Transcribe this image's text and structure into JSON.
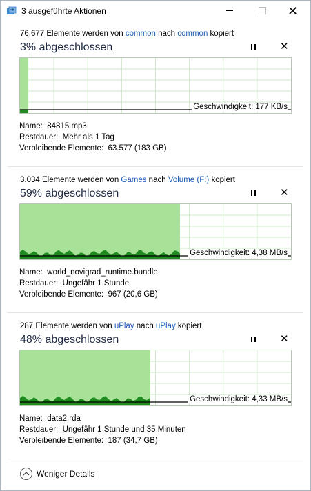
{
  "window": {
    "title": "3 ausgeführte Aktionen",
    "icon": "copy-files-icon",
    "controls": [
      "minimize-icon",
      "maximize-icon",
      "close-icon"
    ]
  },
  "operations": [
    {
      "count": "76.677",
      "text_mid": " Elemente werden von ",
      "source": "common",
      "text_to": " nach ",
      "dest": "common",
      "text_end": " kopiert",
      "percent_label": "3% abgeschlossen",
      "progress": 0.03,
      "speed_label": "Geschwindigkeit: 177 KB/s",
      "name_label": "Name:",
      "name_value": "84815.mp3",
      "remaining_label": "Restdauer:",
      "remaining_value": "Mehr als 1 Tag",
      "items_label": "Verbleibende Elemente:",
      "items_value": "63.577 (183 GB)"
    },
    {
      "count": "3.034",
      "text_mid": " Elemente werden von ",
      "source": "Games",
      "text_to": " nach ",
      "dest": "Volume (F:)",
      "text_end": " kopiert",
      "percent_label": "59% abgeschlossen",
      "progress": 0.59,
      "speed_label": "Geschwindigkeit: 4,38 MB/s",
      "name_label": "Name:",
      "name_value": "world_novigrad_runtime.bundle",
      "remaining_label": "Restdauer:",
      "remaining_value": "Ungefähr 1 Stunde",
      "items_label": "Verbleibende Elemente:",
      "items_value": "967 (20,6 GB)"
    },
    {
      "count": "287",
      "text_mid": " Elemente werden von ",
      "source": "uPlay",
      "text_to": " nach ",
      "dest": "uPlay",
      "text_end": " kopiert",
      "percent_label": "48% abgeschlossen",
      "progress": 0.48,
      "speed_label": "Geschwindigkeit: 4,33 MB/s",
      "name_label": "Name:",
      "name_value": "data2.rda",
      "remaining_label": "Restdauer:",
      "remaining_value": "Ungefähr 1 Stunde und 35 Minuten",
      "items_label": "Verbleibende Elemente:",
      "items_value": "187 (34,7 GB)"
    }
  ],
  "icons": {
    "pause": "pause-icon",
    "stop": "stop-icon",
    "details_toggle": "chevron-up-icon"
  },
  "footer": {
    "less_details": "Weniger Details"
  },
  "colors": {
    "progress_fill": "#a8e298",
    "link": "#1a5bb5",
    "grid": "#cfe8c9",
    "speed_line": "#000000",
    "wave": "#1f8a1f"
  }
}
